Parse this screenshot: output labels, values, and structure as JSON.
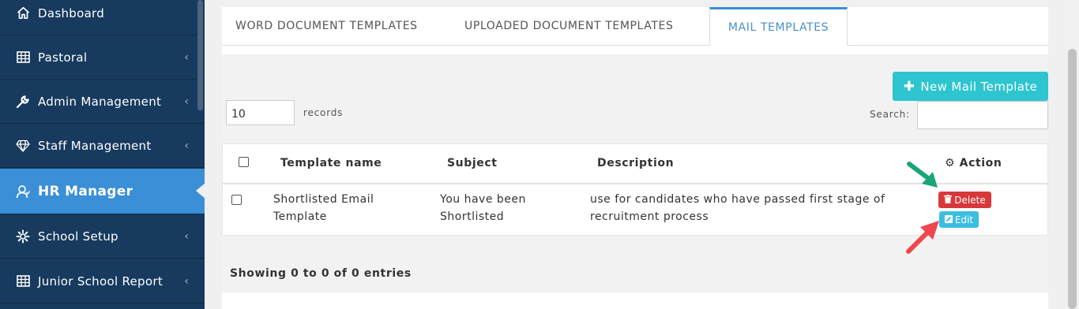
{
  "sidebar": {
    "items": [
      {
        "label": "Dashboard",
        "icon": "home-icon",
        "has_chevron": false
      },
      {
        "label": "Pastoral",
        "icon": "table-icon",
        "has_chevron": true
      },
      {
        "label": "Admin Management",
        "icon": "wrench-icon",
        "has_chevron": true
      },
      {
        "label": "Staff Management",
        "icon": "diamond-icon",
        "has_chevron": true
      },
      {
        "label": "HR Manager",
        "icon": "user-icon",
        "has_chevron": false,
        "active": true
      },
      {
        "label": "School Setup",
        "icon": "gear-icon",
        "has_chevron": true
      },
      {
        "label": "Junior School Report",
        "icon": "table-icon",
        "has_chevron": true
      }
    ],
    "chevron": "‹"
  },
  "tabs": [
    {
      "label": "WORD DOCUMENT TEMPLATES",
      "active": false
    },
    {
      "label": "UPLOADED DOCUMENT TEMPLATES",
      "active": false
    },
    {
      "label": "MAIL TEMPLATES",
      "active": true
    }
  ],
  "toolbar": {
    "new_button": "New Mail Template",
    "records_value": "10",
    "records_label": "records",
    "search_label": "Search:"
  },
  "table": {
    "headers": {
      "name": "Template name",
      "subject": "Subject",
      "description": "Description",
      "action": "Action"
    },
    "rows": [
      {
        "name_line1": "Shortlisted Email",
        "name_line2": "Template",
        "subject_line1": "You have been",
        "subject_line2": "Shortlisted",
        "description_line1": "use for candidates who have passed first stage of",
        "description_line2": "recruitment process",
        "delete_label": "Delete",
        "edit_label": "Edit"
      }
    ]
  },
  "footer": {
    "showing": "Showing 0 to 0 of 0 entries"
  },
  "colors": {
    "sidebar": "#173a5e",
    "sidebar_active": "#3b8fd6",
    "new_button": "#2dc5cf",
    "delete": "#d9383a",
    "edit": "#3bbfe0",
    "annotation_green": "#1aa578",
    "annotation_red": "#f0464f"
  }
}
